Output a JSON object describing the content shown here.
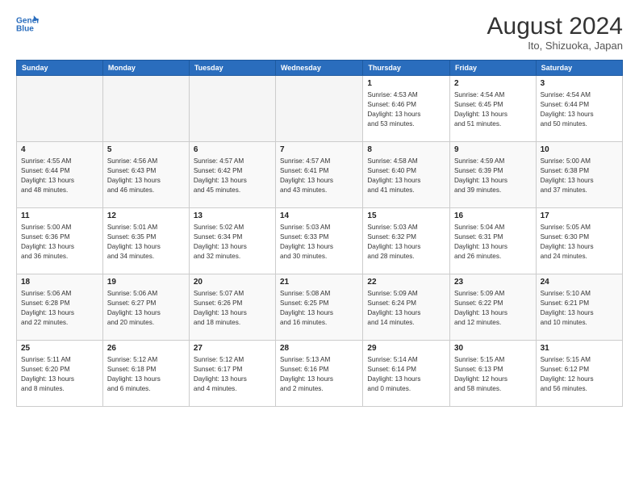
{
  "header": {
    "logo_line1": "General",
    "logo_line2": "Blue",
    "month_year": "August 2024",
    "location": "Ito, Shizuoka, Japan"
  },
  "weekdays": [
    "Sunday",
    "Monday",
    "Tuesday",
    "Wednesday",
    "Thursday",
    "Friday",
    "Saturday"
  ],
  "weeks": [
    [
      {
        "day": "",
        "info": ""
      },
      {
        "day": "",
        "info": ""
      },
      {
        "day": "",
        "info": ""
      },
      {
        "day": "",
        "info": ""
      },
      {
        "day": "1",
        "info": "Sunrise: 4:53 AM\nSunset: 6:46 PM\nDaylight: 13 hours\nand 53 minutes."
      },
      {
        "day": "2",
        "info": "Sunrise: 4:54 AM\nSunset: 6:45 PM\nDaylight: 13 hours\nand 51 minutes."
      },
      {
        "day": "3",
        "info": "Sunrise: 4:54 AM\nSunset: 6:44 PM\nDaylight: 13 hours\nand 50 minutes."
      }
    ],
    [
      {
        "day": "4",
        "info": "Sunrise: 4:55 AM\nSunset: 6:44 PM\nDaylight: 13 hours\nand 48 minutes."
      },
      {
        "day": "5",
        "info": "Sunrise: 4:56 AM\nSunset: 6:43 PM\nDaylight: 13 hours\nand 46 minutes."
      },
      {
        "day": "6",
        "info": "Sunrise: 4:57 AM\nSunset: 6:42 PM\nDaylight: 13 hours\nand 45 minutes."
      },
      {
        "day": "7",
        "info": "Sunrise: 4:57 AM\nSunset: 6:41 PM\nDaylight: 13 hours\nand 43 minutes."
      },
      {
        "day": "8",
        "info": "Sunrise: 4:58 AM\nSunset: 6:40 PM\nDaylight: 13 hours\nand 41 minutes."
      },
      {
        "day": "9",
        "info": "Sunrise: 4:59 AM\nSunset: 6:39 PM\nDaylight: 13 hours\nand 39 minutes."
      },
      {
        "day": "10",
        "info": "Sunrise: 5:00 AM\nSunset: 6:38 PM\nDaylight: 13 hours\nand 37 minutes."
      }
    ],
    [
      {
        "day": "11",
        "info": "Sunrise: 5:00 AM\nSunset: 6:36 PM\nDaylight: 13 hours\nand 36 minutes."
      },
      {
        "day": "12",
        "info": "Sunrise: 5:01 AM\nSunset: 6:35 PM\nDaylight: 13 hours\nand 34 minutes."
      },
      {
        "day": "13",
        "info": "Sunrise: 5:02 AM\nSunset: 6:34 PM\nDaylight: 13 hours\nand 32 minutes."
      },
      {
        "day": "14",
        "info": "Sunrise: 5:03 AM\nSunset: 6:33 PM\nDaylight: 13 hours\nand 30 minutes."
      },
      {
        "day": "15",
        "info": "Sunrise: 5:03 AM\nSunset: 6:32 PM\nDaylight: 13 hours\nand 28 minutes."
      },
      {
        "day": "16",
        "info": "Sunrise: 5:04 AM\nSunset: 6:31 PM\nDaylight: 13 hours\nand 26 minutes."
      },
      {
        "day": "17",
        "info": "Sunrise: 5:05 AM\nSunset: 6:30 PM\nDaylight: 13 hours\nand 24 minutes."
      }
    ],
    [
      {
        "day": "18",
        "info": "Sunrise: 5:06 AM\nSunset: 6:28 PM\nDaylight: 13 hours\nand 22 minutes."
      },
      {
        "day": "19",
        "info": "Sunrise: 5:06 AM\nSunset: 6:27 PM\nDaylight: 13 hours\nand 20 minutes."
      },
      {
        "day": "20",
        "info": "Sunrise: 5:07 AM\nSunset: 6:26 PM\nDaylight: 13 hours\nand 18 minutes."
      },
      {
        "day": "21",
        "info": "Sunrise: 5:08 AM\nSunset: 6:25 PM\nDaylight: 13 hours\nand 16 minutes."
      },
      {
        "day": "22",
        "info": "Sunrise: 5:09 AM\nSunset: 6:24 PM\nDaylight: 13 hours\nand 14 minutes."
      },
      {
        "day": "23",
        "info": "Sunrise: 5:09 AM\nSunset: 6:22 PM\nDaylight: 13 hours\nand 12 minutes."
      },
      {
        "day": "24",
        "info": "Sunrise: 5:10 AM\nSunset: 6:21 PM\nDaylight: 13 hours\nand 10 minutes."
      }
    ],
    [
      {
        "day": "25",
        "info": "Sunrise: 5:11 AM\nSunset: 6:20 PM\nDaylight: 13 hours\nand 8 minutes."
      },
      {
        "day": "26",
        "info": "Sunrise: 5:12 AM\nSunset: 6:18 PM\nDaylight: 13 hours\nand 6 minutes."
      },
      {
        "day": "27",
        "info": "Sunrise: 5:12 AM\nSunset: 6:17 PM\nDaylight: 13 hours\nand 4 minutes."
      },
      {
        "day": "28",
        "info": "Sunrise: 5:13 AM\nSunset: 6:16 PM\nDaylight: 13 hours\nand 2 minutes."
      },
      {
        "day": "29",
        "info": "Sunrise: 5:14 AM\nSunset: 6:14 PM\nDaylight: 13 hours\nand 0 minutes."
      },
      {
        "day": "30",
        "info": "Sunrise: 5:15 AM\nSunset: 6:13 PM\nDaylight: 12 hours\nand 58 minutes."
      },
      {
        "day": "31",
        "info": "Sunrise: 5:15 AM\nSunset: 6:12 PM\nDaylight: 12 hours\nand 56 minutes."
      }
    ]
  ]
}
